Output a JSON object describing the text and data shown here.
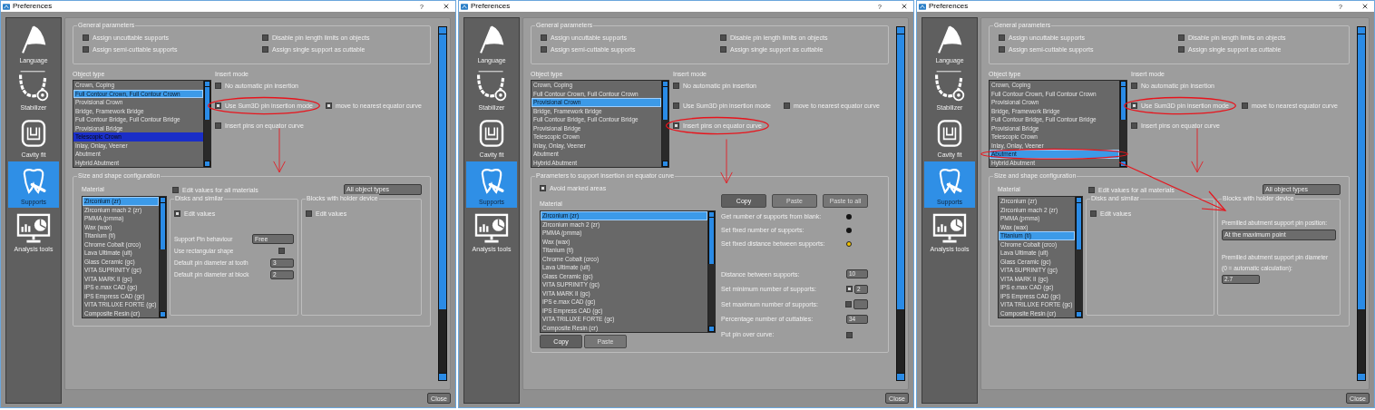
{
  "windows": [
    {
      "title": "Preferences",
      "help": "?",
      "close": "Close",
      "nav": [
        {
          "kind": "language",
          "label": "Language",
          "selected": false
        },
        {
          "kind": "stabilizer",
          "label": "Stabilizer",
          "selected": false
        },
        {
          "kind": "cavity",
          "label": "Cavity fit",
          "selected": false
        },
        {
          "kind": "supports",
          "label": "Supports",
          "selected": true
        },
        {
          "kind": "analysis",
          "label": "Analysis tools",
          "selected": false
        }
      ],
      "general": {
        "title": "General parameters",
        "options": [
          {
            "label": "Assign uncuttable supports",
            "checked": false
          },
          {
            "label": "Disable pin length limits on objects",
            "checked": false
          },
          {
            "label": "Assign semi-cuttable supports",
            "checked": false
          },
          {
            "label": "Assign single support as cuttable",
            "checked": false
          }
        ]
      },
      "object_type": {
        "label": "Object type",
        "items": [
          {
            "label": "Crown, Coping",
            "selected": false
          },
          {
            "label": "Full Contour Crown, Full Contour Crown",
            "selected": true
          },
          {
            "label": "Provisional Crown",
            "selected": false
          },
          {
            "label": "Bridge, Framework Bridge",
            "selected": false
          },
          {
            "label": "Full Contour Bridge, Full Contour Bridge",
            "selected": false
          },
          {
            "label": "Provisional Bridge",
            "selected": false
          },
          {
            "label": "Telescopic Crown",
            "selected": false,
            "hovered": true
          },
          {
            "label": "Inlay, Onlay, Veener",
            "selected": false
          },
          {
            "label": "Abutment",
            "selected": false
          },
          {
            "label": "Hybrid Abutment",
            "selected": false
          }
        ]
      },
      "insert_mode": {
        "label": "Insert mode",
        "options": [
          {
            "label": "No automatic pin insertion",
            "checked": false
          },
          {
            "label": "Use Sum3D pin insertion mode",
            "checked": true,
            "circled": true,
            "extra": {
              "label": "move to nearest equator curve",
              "checked": true
            }
          },
          {
            "label": "Insert pins on equator curve",
            "checked": false
          }
        ]
      },
      "lower": {
        "kind": "size_shape",
        "title": "Size and shape configuration",
        "arrowed": true,
        "material_label": "Material",
        "all_materials": {
          "label": "Edit values for all materials",
          "checked": false
        },
        "object_types": "All object types",
        "materials": [
          {
            "label": "Zirconium (zr)",
            "selected": true
          },
          {
            "label": "Zirconium mach 2 (zr)",
            "selected": false
          },
          {
            "label": "PMMA (pmma)",
            "selected": false
          },
          {
            "label": "Wax (wax)",
            "selected": false
          },
          {
            "label": "Titanium (ti)",
            "selected": false
          },
          {
            "label": "Chrome Cobalt (crco)",
            "selected": false
          },
          {
            "label": "Lava Ultimate (ult)",
            "selected": false
          },
          {
            "label": "Glass Ceramic (gc)",
            "selected": false
          },
          {
            "label": "VITA SUPRINITY (gc)",
            "selected": false
          },
          {
            "label": "VITA MARK II (gc)",
            "selected": false
          },
          {
            "label": "IPS e.max CAD (gc)",
            "selected": false
          },
          {
            "label": "IPS Empress CAD (gc)",
            "selected": false
          },
          {
            "label": "VITA TRILUXE FORTE (gc)",
            "selected": false
          },
          {
            "label": "Composite Resin (cr)",
            "selected": false
          }
        ],
        "disks": {
          "title": "Disks and similar",
          "edit": {
            "label": "Edit values",
            "checked": true
          },
          "fields": [
            {
              "kind": "select",
              "label": "Support Pin behaviour",
              "value": "Free"
            },
            {
              "kind": "checkbox",
              "label": "Use rectangular shape",
              "checked": false
            },
            {
              "kind": "input",
              "label": "Default pin diameter at tooth",
              "value": "3"
            },
            {
              "kind": "input",
              "label": "Default pin diameter at block",
              "value": "2"
            }
          ]
        },
        "blocks": {
          "title": "Blocks with holder device",
          "edit": {
            "label": "Edit values",
            "checked": false
          }
        }
      }
    },
    {
      "title": "Preferences",
      "help": "?",
      "close": "Close",
      "nav": [
        {
          "kind": "language",
          "label": "Language",
          "selected": false
        },
        {
          "kind": "stabilizer",
          "label": "Stabilizer",
          "selected": false
        },
        {
          "kind": "cavity",
          "label": "Cavity fit",
          "selected": false
        },
        {
          "kind": "supports",
          "label": "Supports",
          "selected": true
        },
        {
          "kind": "analysis",
          "label": "Analysis tools",
          "selected": false
        }
      ],
      "general": {
        "title": "General parameters",
        "options": [
          {
            "label": "Assign uncuttable supports",
            "checked": false
          },
          {
            "label": "Disable pin length limits on objects",
            "checked": false
          },
          {
            "label": "Assign semi-cuttable supports",
            "checked": false
          },
          {
            "label": "Assign single support as cuttable",
            "checked": false
          }
        ]
      },
      "object_type": {
        "label": "Object type",
        "items": [
          {
            "label": "Crown, Coping",
            "selected": false
          },
          {
            "label": "Full Contour Crown, Full Contour Crown",
            "selected": false
          },
          {
            "label": "Provisional Crown",
            "selected": true
          },
          {
            "label": "Bridge, Framework Bridge",
            "selected": false
          },
          {
            "label": "Full Contour Bridge, Full Contour Bridge",
            "selected": false
          },
          {
            "label": "Provisional Bridge",
            "selected": false
          },
          {
            "label": "Telescopic Crown",
            "selected": false
          },
          {
            "label": "Inlay, Onlay, Veener",
            "selected": false
          },
          {
            "label": "Abutment",
            "selected": false
          },
          {
            "label": "Hybrid Abutment",
            "selected": false
          }
        ]
      },
      "insert_mode": {
        "label": "Insert mode",
        "options": [
          {
            "label": "No automatic pin insertion",
            "checked": false
          },
          {
            "label": "Use Sum3D pin insertion mode",
            "checked": false,
            "extra": {
              "label": "move to nearest equator curve",
              "checked": false
            }
          },
          {
            "label": "Insert pins on equator curve",
            "checked": true,
            "circled": true
          }
        ]
      },
      "lower": {
        "kind": "equator",
        "title": "Parameters to support insertion on equator curve",
        "arrowed": true,
        "avoid": {
          "label": "Avoid marked areas",
          "checked": true
        },
        "material_label": "Material",
        "materials": [
          {
            "label": "Zirconium (zr)",
            "selected": true
          },
          {
            "label": "Zirconium mach 2 (zr)",
            "selected": false
          },
          {
            "label": "PMMA (pmma)",
            "selected": false
          },
          {
            "label": "Wax (wax)",
            "selected": false
          },
          {
            "label": "Titanium (ti)",
            "selected": false
          },
          {
            "label": "Chrome Cobalt (crco)",
            "selected": false
          },
          {
            "label": "Lava Ultimate (ult)",
            "selected": false
          },
          {
            "label": "Glass Ceramic (gc)",
            "selected": false
          },
          {
            "label": "VITA SUPRINITY (gc)",
            "selected": false
          },
          {
            "label": "VITA MARK II (gc)",
            "selected": false
          },
          {
            "label": "IPS e.max CAD (gc)",
            "selected": false
          },
          {
            "label": "IPS Empress CAD (gc)",
            "selected": false
          },
          {
            "label": "VITA TRILUXE FORTE (gc)",
            "selected": false
          },
          {
            "label": "Composite Resin (cr)",
            "selected": false
          }
        ],
        "buttons": [
          {
            "label": "Copy",
            "disabled": false
          },
          {
            "label": "Paste",
            "disabled": true
          },
          {
            "label": "Paste to all",
            "disabled": true
          }
        ],
        "modes": [
          {
            "label": "Get number of supports from blank:",
            "selected": false
          },
          {
            "label": "Set fixed number of supports:",
            "selected": false
          },
          {
            "label": "Set fixed distance between supports:",
            "selected": true
          }
        ],
        "fields": [
          {
            "kind": "input",
            "label": "Distance between supports:",
            "value": "10"
          },
          {
            "kind": "check_input",
            "label": "Set minimum number of supports:",
            "checked": true,
            "value": "2"
          },
          {
            "kind": "check_input",
            "label": "Set maximum number of supports:",
            "checked": false
          },
          {
            "kind": "input",
            "label": "Percentage number of cuttables:",
            "value": "34"
          },
          {
            "kind": "checkbox",
            "label": "Put pin over curve:",
            "checked": false
          }
        ],
        "list_buttons": [
          {
            "label": "Copy",
            "disabled": false
          },
          {
            "label": "Paste",
            "disabled": true
          }
        ]
      }
    },
    {
      "title": "Preferences",
      "help": "?",
      "close": "Close",
      "nav": [
        {
          "kind": "language",
          "label": "Language",
          "selected": false
        },
        {
          "kind": "stabilizer",
          "label": "Stabilizer",
          "selected": false
        },
        {
          "kind": "cavity",
          "label": "Cavity fit",
          "selected": false
        },
        {
          "kind": "supports",
          "label": "Supports",
          "selected": true
        },
        {
          "kind": "analysis",
          "label": "Analysis tools",
          "selected": false
        }
      ],
      "general": {
        "title": "General parameters",
        "options": [
          {
            "label": "Assign uncuttable supports",
            "checked": false
          },
          {
            "label": "Disable pin length limits on objects",
            "checked": false
          },
          {
            "label": "Assign semi-cuttable supports",
            "checked": false
          },
          {
            "label": "Assign single support as cuttable",
            "checked": false
          }
        ]
      },
      "object_type": {
        "label": "Object type",
        "items": [
          {
            "label": "Crown, Coping",
            "selected": false
          },
          {
            "label": "Full Contour Crown, Full Contour Crown",
            "selected": false
          },
          {
            "label": "Provisional Crown",
            "selected": false
          },
          {
            "label": "Bridge, Framework Bridge",
            "selected": false
          },
          {
            "label": "Full Contour Bridge, Full Contour Bridge",
            "selected": false
          },
          {
            "label": "Provisional Bridge",
            "selected": false
          },
          {
            "label": "Telescopic Crown",
            "selected": false
          },
          {
            "label": "Inlay, Onlay, Veener",
            "selected": false
          },
          {
            "label": "Abutment",
            "selected": true,
            "circled": true
          },
          {
            "label": "Hybrid Abutment",
            "selected": false
          }
        ]
      },
      "insert_mode": {
        "label": "Insert mode",
        "options": [
          {
            "label": "No automatic pin insertion",
            "checked": false
          },
          {
            "label": "Use Sum3D pin insertion mode",
            "checked": true,
            "circled": true,
            "extra": {
              "label": "move to nearest equator curve",
              "checked": false
            }
          },
          {
            "label": "Insert pins on equator curve",
            "checked": false
          }
        ]
      },
      "lower": {
        "kind": "size_shape",
        "title": "Size and shape configuration",
        "arrowed": true,
        "material_label": "Material",
        "all_materials": {
          "label": "Edit values for all materials",
          "checked": false
        },
        "object_types": "All object types",
        "materials": [
          {
            "label": "Zirconium (zr)",
            "selected": false
          },
          {
            "label": "Zirconium mach 2 (zr)",
            "selected": false
          },
          {
            "label": "PMMA (pmma)",
            "selected": false
          },
          {
            "label": "Wax (wax)",
            "selected": false
          },
          {
            "label": "Titanium (ti)",
            "selected": true
          },
          {
            "label": "Chrome Cobalt (crco)",
            "selected": false
          },
          {
            "label": "Lava Ultimate (ult)",
            "selected": false
          },
          {
            "label": "Glass Ceramic (gc)",
            "selected": false
          },
          {
            "label": "VITA SUPRINITY (gc)",
            "selected": false
          },
          {
            "label": "VITA MARK II (gc)",
            "selected": false
          },
          {
            "label": "IPS e.max CAD (gc)",
            "selected": false
          },
          {
            "label": "IPS Empress CAD (gc)",
            "selected": false
          },
          {
            "label": "VITA TRILUXE FORTE (gc)",
            "selected": false
          },
          {
            "label": "Composite Resin (cr)",
            "selected": false
          }
        ],
        "disks": {
          "title": "Disks and similar",
          "edit": {
            "label": "Edit values",
            "checked": false
          }
        },
        "blocks": {
          "title": "Blocks with holder device",
          "arrowed": true,
          "fields": [
            {
              "kind": "wide_select",
              "label": "Premilled abutment support pin position:",
              "value": "At the maximum point"
            },
            {
              "kind": "wide_input",
              "label": "Premilled abutment support pin diameter",
              "note": "(0 = automatic calculation):",
              "value": "2.7"
            }
          ]
        }
      }
    }
  ]
}
